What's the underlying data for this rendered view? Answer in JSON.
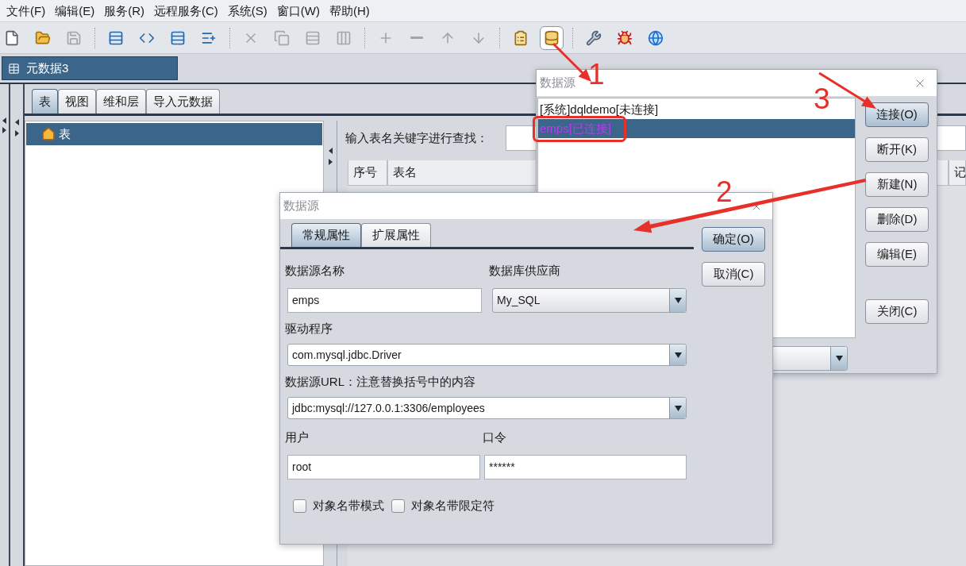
{
  "menu_bar": [
    {
      "label": "文件(F)"
    },
    {
      "label": "编辑(E)"
    },
    {
      "label": "服务(R)"
    },
    {
      "label": "远程服务(C)"
    },
    {
      "label": "系统(S)"
    },
    {
      "label": "窗口(W)"
    },
    {
      "label": "帮助(H)"
    }
  ],
  "toolbar": [
    {
      "buttons": [
        {
          "disabled": false,
          "selected": false
        },
        {
          "disabled": false,
          "selected": false
        },
        {
          "disabled": true,
          "selected": false
        }
      ]
    },
    {
      "buttons": [
        {
          "disabled": false,
          "selected": false
        },
        {
          "disabled": false,
          "selected": false
        },
        {
          "disabled": false,
          "selected": false
        },
        {
          "disabled": false,
          "selected": false
        }
      ]
    },
    {
      "buttons": [
        {
          "disabled": true,
          "selected": false
        },
        {
          "disabled": true,
          "selected": false
        },
        {
          "disabled": true,
          "selected": false
        },
        {
          "disabled": true,
          "selected": false
        }
      ]
    },
    {
      "buttons": [
        {
          "disabled": true,
          "selected": false
        },
        {
          "disabled": true,
          "selected": false
        },
        {
          "disabled": true,
          "selected": false
        },
        {
          "disabled": true,
          "selected": false
        }
      ]
    },
    {
      "buttons": [
        {
          "disabled": false,
          "selected": false
        },
        {
          "disabled": false,
          "selected": true
        }
      ]
    },
    {
      "buttons": [
        {
          "disabled": false,
          "selected": false
        },
        {
          "disabled": false,
          "selected": false
        },
        {
          "disabled": false,
          "selected": false
        }
      ]
    }
  ],
  "document_tabs": [
    {
      "label": "元数据3",
      "selected": true
    }
  ],
  "panel_tabs": [
    {
      "label": "表",
      "selected": true
    },
    {
      "label": "视图",
      "selected": false
    },
    {
      "label": "维和层",
      "selected": false
    },
    {
      "label": "导入元数据",
      "selected": false
    }
  ],
  "tree": [
    {
      "label": "表",
      "selected": true
    }
  ],
  "search": {
    "label": "输入表名关键字进行查找："
  },
  "table": {
    "columns": [
      "序号",
      "表名",
      "记"
    ]
  },
  "datasource_list_dialog": {
    "title": "数据源",
    "items": [
      {
        "label": "[系统]dqldemo[未连接]",
        "selected": false,
        "connected": false
      },
      {
        "label": "emps[已连接]",
        "selected": true,
        "connected": true
      }
    ],
    "buttons": [
      {
        "label": "连接(O)",
        "focused": true
      },
      {
        "label": "断开(K)",
        "focused": false
      },
      {
        "label": "新建(N)",
        "focused": false
      },
      {
        "label": "删除(D)",
        "focused": false
      },
      {
        "label": "编辑(E)",
        "focused": false
      }
    ],
    "close_button": {
      "label": "关闭(C)",
      "focused": false
    }
  },
  "datasource_edit_dialog": {
    "title": "数据源",
    "tabs": [
      {
        "label": "常规属性",
        "selected": true
      },
      {
        "label": "扩展属性",
        "selected": false
      }
    ],
    "name": {
      "label": "数据源名称",
      "value": "emps"
    },
    "vendor": {
      "label": "数据库供应商",
      "value": "My_SQL"
    },
    "driver": {
      "label": "驱动程序",
      "value": "com.mysql.jdbc.Driver"
    },
    "url": {
      "label": "数据源URL：注意替换括号中的内容",
      "value": "jdbc:mysql://127.0.0.1:3306/employees"
    },
    "user": {
      "label": "用户",
      "value": "root"
    },
    "password": {
      "label": "口令",
      "value": "******"
    },
    "checkboxes": [
      {
        "label": "对象名带模式",
        "checked": false
      },
      {
        "label": "对象名带限定符",
        "checked": false
      }
    ],
    "buttons": [
      {
        "label": "确定(O)",
        "focused": true
      },
      {
        "label": "取消(C)",
        "focused": false
      }
    ]
  },
  "annotations": [
    {
      "label": "1"
    },
    {
      "label": "2"
    },
    {
      "label": "3"
    }
  ]
}
